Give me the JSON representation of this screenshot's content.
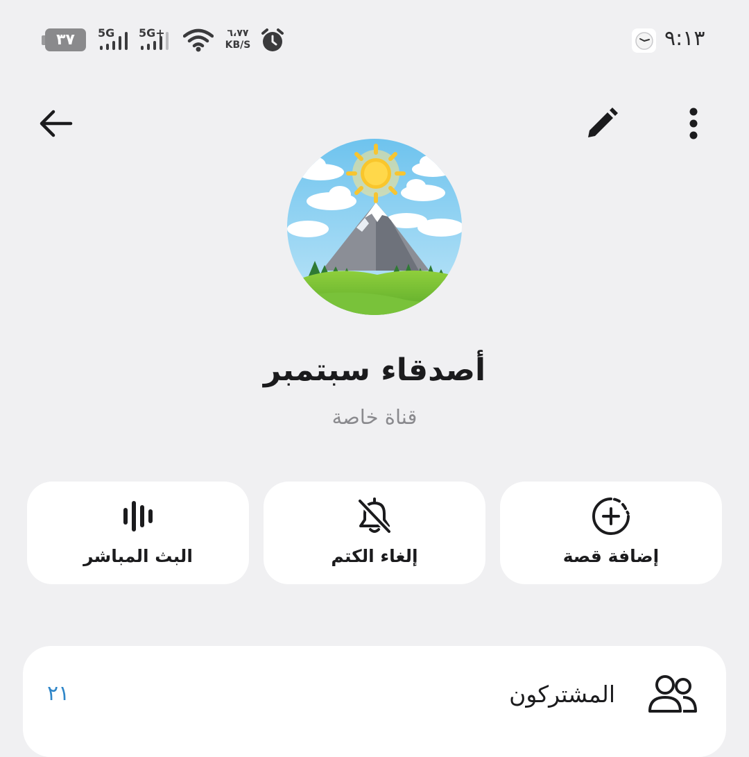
{
  "status_bar": {
    "battery": "٣٧",
    "signal1_label": "5G",
    "signal2_label": "5G+",
    "net_speed_value": "٦،٧٧",
    "net_speed_unit": "KB/S",
    "time": "٩:١٣"
  },
  "header": {
    "back_icon": "arrow-left",
    "edit_icon": "pencil",
    "more_icon": "vertical-dots"
  },
  "channel": {
    "name": "أصدقاء سبتمبر",
    "type": "قناة خاصة",
    "avatar": "sun-mountain-landscape"
  },
  "actions": [
    {
      "label": "البث المباشر",
      "icon": "live-stream-bars"
    },
    {
      "label": "إلغاء الكتم",
      "icon": "bell-off"
    },
    {
      "label": "إضافة قصة",
      "icon": "add-story-circle"
    }
  ],
  "members": {
    "label": "المشتركون",
    "count": "٢١",
    "icon": "people"
  },
  "colors": {
    "background": "#f0f0f2",
    "card": "#ffffff",
    "accent": "#2f86c8",
    "secondary_text": "#8a8a8e"
  }
}
